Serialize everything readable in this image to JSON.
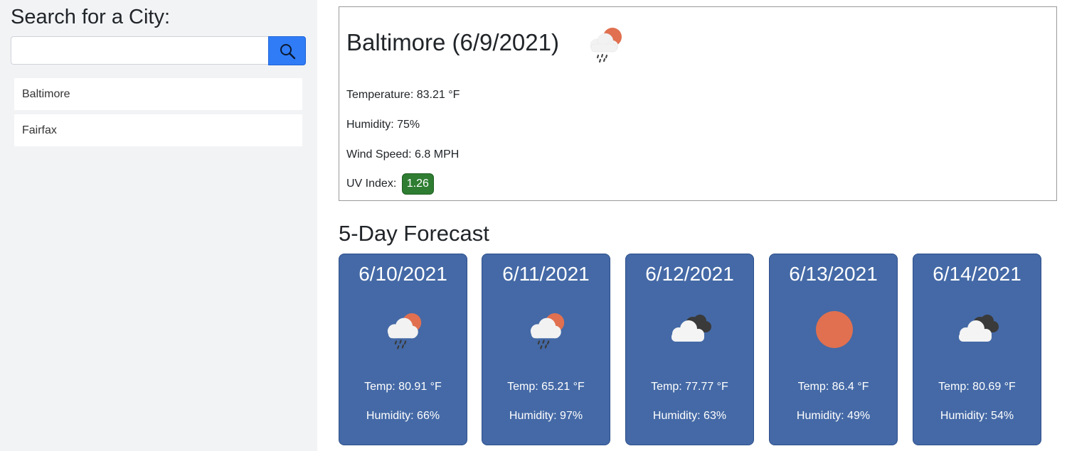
{
  "sidebar": {
    "heading": "Search for a City:",
    "search": {
      "placeholder": "",
      "value": "",
      "button_icon": "search-icon"
    },
    "history": [
      "Baltimore",
      "Fairfax"
    ]
  },
  "current": {
    "title": "Baltimore (6/9/2021)",
    "icon": "sun-cloud-rain-icon",
    "temperature": "Temperature: 83.21 °F",
    "humidity": "Humidity: 75%",
    "wind": "Wind Speed: 6.8 MPH",
    "uv_label": "UV Index:",
    "uv_value": "1.26",
    "uv_color": "#2e7d32"
  },
  "forecast": {
    "title": "5-Day Forecast",
    "days": [
      {
        "date": "6/10/2021",
        "icon": "sun-cloud-rain-icon",
        "temp": "Temp: 80.91 °F",
        "humidity": "Humidity: 66%"
      },
      {
        "date": "6/11/2021",
        "icon": "sun-cloud-rain-icon",
        "temp": "Temp: 65.21 °F",
        "humidity": "Humidity: 97%"
      },
      {
        "date": "6/12/2021",
        "icon": "clouds-icon",
        "temp": "Temp: 77.77 °F",
        "humidity": "Humidity: 63%"
      },
      {
        "date": "6/13/2021",
        "icon": "sun-icon",
        "temp": "Temp: 86.4 °F",
        "humidity": "Humidity: 49%"
      },
      {
        "date": "6/14/2021",
        "icon": "clouds-icon",
        "temp": "Temp: 80.69 °F",
        "humidity": "Humidity: 54%"
      }
    ]
  },
  "colors": {
    "accent": "#2f7cf6",
    "card_bg": "#4469a6",
    "sun": "#e07050",
    "dark_cloud": "#444444"
  }
}
